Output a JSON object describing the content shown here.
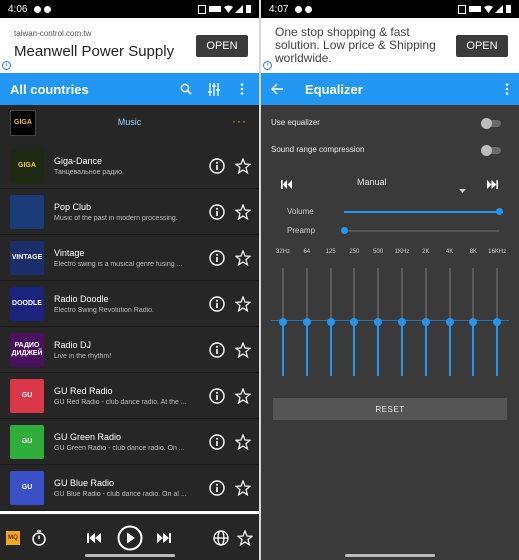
{
  "left": {
    "status": {
      "time": "4:06"
    },
    "ad": {
      "domain": "taiwan-control.com.tw",
      "headline": "Meanwell Power Supply",
      "button": "OPEN",
      "info": "i"
    },
    "appbar": {
      "title": "All countries"
    },
    "genre": {
      "logo_text": "GIGA",
      "label": "Music",
      "more": "···"
    },
    "stations": [
      {
        "name": "Giga-Dance",
        "desc": "Танцевальное радио.",
        "thumb_text": "GIGA",
        "thumb_bg": "#1f2a12",
        "thumb_color": "#f0c32b"
      },
      {
        "name": "Pop Club",
        "desc": "Music of the past in modern processing.",
        "thumb_text": "",
        "thumb_bg": "#1a3d7a",
        "thumb_color": "#ffffff"
      },
      {
        "name": "Vintage",
        "desc": "Electro swing is a musical genre fusing ...",
        "thumb_text": "VINTAGE",
        "thumb_bg": "#1b2e6b",
        "thumb_color": "#ffffff"
      },
      {
        "name": "Radio Doodle",
        "desc": "Electro Swing Revolution Radio.",
        "thumb_text": "DOODLE",
        "thumb_bg": "#1a237e",
        "thumb_color": "#ffffff"
      },
      {
        "name": "Radio DJ",
        "desc": "Live in the rhythm!",
        "thumb_text": "РАДИО ДИДЖЕЙ",
        "thumb_bg": "#4a0f5e",
        "thumb_color": "#ffffff"
      },
      {
        "name": "GU Red Radio",
        "desc": "GU Red Radio - club dance radio. At the ...",
        "thumb_text": "GU",
        "thumb_bg": "#d9364a",
        "thumb_color": "#ffffff"
      },
      {
        "name": "GU Green Radio",
        "desc": "GU Green Radio - club dance radio. On ...",
        "thumb_text": "GU",
        "thumb_bg": "#2fae3a",
        "thumb_color": "#ffffff"
      },
      {
        "name": "GU Blue Radio",
        "desc": "GU Blue Radio - club dance radio. On al ...",
        "thumb_text": "GU",
        "thumb_bg": "#3b4fc7",
        "thumb_color": "#ffffff"
      }
    ],
    "player": {
      "mq_label": "MQ"
    }
  },
  "right": {
    "status": {
      "time": "4:07"
    },
    "ad": {
      "text": "One stop shopping & fast solution. Low price & Shipping worldwide.",
      "button": "OPEN",
      "info": "i"
    },
    "appbar": {
      "title": "Equalizer"
    },
    "use_equalizer": {
      "label": "Use equalizer",
      "on": false
    },
    "sound_range": {
      "label": "Sound range compression",
      "on": false
    },
    "preset": {
      "value": "Manual"
    },
    "volume": {
      "label": "Volume",
      "level": 1.0
    },
    "preamp": {
      "label": "Preamp",
      "level": 0.0
    },
    "bands": [
      {
        "label": "32Hz",
        "level": 0.5
      },
      {
        "label": "64",
        "level": 0.5
      },
      {
        "label": "125",
        "level": 0.5
      },
      {
        "label": "250",
        "level": 0.5
      },
      {
        "label": "500",
        "level": 0.5
      },
      {
        "label": "1KHz",
        "level": 0.5
      },
      {
        "label": "2K",
        "level": 0.5
      },
      {
        "label": "4K",
        "level": 0.5
      },
      {
        "label": "8K",
        "level": 0.5
      },
      {
        "label": "16KHz",
        "level": 0.5
      }
    ],
    "reset": {
      "label": "RESET"
    }
  },
  "colors": {
    "accent": "#2196f3",
    "dark_bg": "#262626",
    "eq_bg": "#3a3a3a",
    "genre_label": "#8fd3ff",
    "dots": "#f5a623"
  }
}
